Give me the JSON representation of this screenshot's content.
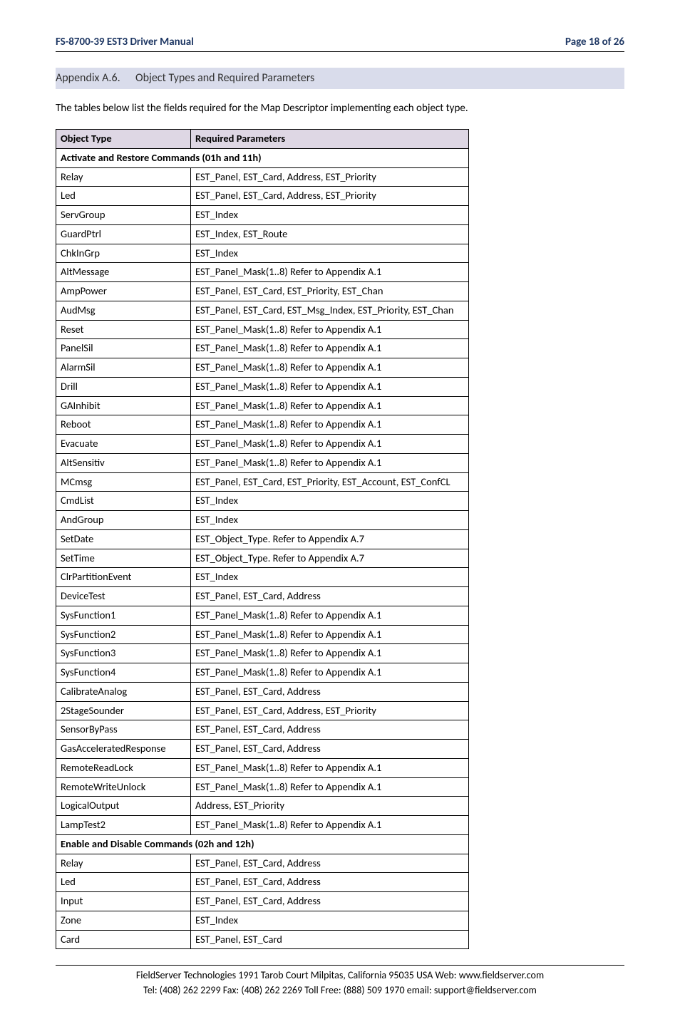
{
  "header": {
    "left": "FS-8700-39 EST3 Driver Manual",
    "right": "Page 18 of 26"
  },
  "section": {
    "number": "Appendix A.6.",
    "title": "Object Types and Required Parameters"
  },
  "intro": "The tables below list the fields required for the Map Descriptor implementing each object type.",
  "table": {
    "columns": [
      "Object Type",
      "Required Parameters"
    ],
    "groups": [
      {
        "heading": "Activate and Restore Commands (01h and 11h)",
        "rows": [
          [
            "Relay",
            "EST_Panel, EST_Card, Address, EST_Priority"
          ],
          [
            "Led",
            "EST_Panel, EST_Card, Address, EST_Priority"
          ],
          [
            "ServGroup",
            "EST_Index"
          ],
          [
            "GuardPtrl",
            "EST_Index, EST_Route"
          ],
          [
            "ChkInGrp",
            "EST_Index"
          ],
          [
            "AltMessage",
            "EST_Panel_Mask(1..8) Refer to Appendix A.1"
          ],
          [
            "AmpPower",
            "EST_Panel, EST_Card, EST_Priority, EST_Chan"
          ],
          [
            "AudMsg",
            "EST_Panel, EST_Card, EST_Msg_Index, EST_Priority, EST_Chan"
          ],
          [
            "Reset",
            "EST_Panel_Mask(1..8) Refer to Appendix A.1"
          ],
          [
            "PanelSil",
            "EST_Panel_Mask(1..8) Refer to Appendix A.1"
          ],
          [
            "AlarmSil",
            "EST_Panel_Mask(1..8) Refer to Appendix A.1"
          ],
          [
            "Drill",
            "EST_Panel_Mask(1..8) Refer to Appendix A.1"
          ],
          [
            "GAInhibit",
            "EST_Panel_Mask(1..8) Refer to Appendix A.1"
          ],
          [
            "Reboot",
            "EST_Panel_Mask(1..8) Refer to Appendix A.1"
          ],
          [
            "Evacuate",
            "EST_Panel_Mask(1..8) Refer to Appendix A.1"
          ],
          [
            "AltSensitiv",
            "EST_Panel_Mask(1..8) Refer to Appendix A.1"
          ],
          [
            "MCmsg",
            "EST_Panel, EST_Card, EST_Priority, EST_Account, EST_ConfCL"
          ],
          [
            "CmdList",
            "EST_Index"
          ],
          [
            "AndGroup",
            "EST_Index"
          ],
          [
            "SetDate",
            "EST_Object_Type.  Refer to Appendix A.7"
          ],
          [
            "SetTime",
            "EST_Object_Type.  Refer to Appendix A.7"
          ],
          [
            "ClrPartitionEvent",
            "EST_Index"
          ],
          [
            "DeviceTest",
            "EST_Panel, EST_Card, Address"
          ],
          [
            "SysFunction1",
            "EST_Panel_Mask(1..8) Refer to Appendix A.1"
          ],
          [
            "SysFunction2",
            "EST_Panel_Mask(1..8) Refer to Appendix A.1"
          ],
          [
            "SysFunction3",
            "EST_Panel_Mask(1..8) Refer to Appendix A.1"
          ],
          [
            "SysFunction4",
            "EST_Panel_Mask(1..8) Refer to Appendix A.1"
          ],
          [
            "CalibrateAnalog",
            "EST_Panel, EST_Card, Address"
          ],
          [
            "2StageSounder",
            "EST_Panel, EST_Card, Address, EST_Priority"
          ],
          [
            "SensorByPass",
            "EST_Panel, EST_Card, Address"
          ],
          [
            "GasAcceleratedResponse",
            "EST_Panel, EST_Card, Address"
          ],
          [
            "RemoteReadLock",
            "EST_Panel_Mask(1..8) Refer to Appendix A.1"
          ],
          [
            "RemoteWriteUnlock",
            "EST_Panel_Mask(1..8) Refer to Appendix A.1"
          ],
          [
            "LogicalOutput",
            "Address, EST_Priority"
          ],
          [
            "LampTest2",
            "EST_Panel_Mask(1..8) Refer to Appendix A.1"
          ]
        ]
      },
      {
        "heading": "Enable and Disable Commands (02h and 12h)",
        "rows": [
          [
            "Relay",
            "EST_Panel, EST_Card, Address"
          ],
          [
            "Led",
            "EST_Panel, EST_Card, Address"
          ],
          [
            "Input",
            "EST_Panel, EST_Card, Address"
          ],
          [
            "Zone",
            "EST_Index"
          ],
          [
            "Card",
            "EST_Panel, EST_Card"
          ]
        ]
      }
    ]
  },
  "footer": {
    "line1": "FieldServer Technologies 1991 Tarob Court Milpitas, California 95035 USA   Web: www.fieldserver.com",
    "line2": "Tel: (408) 262 2299   Fax: (408) 262 2269   Toll Free: (888) 509 1970   email: support@fieldserver.com"
  }
}
